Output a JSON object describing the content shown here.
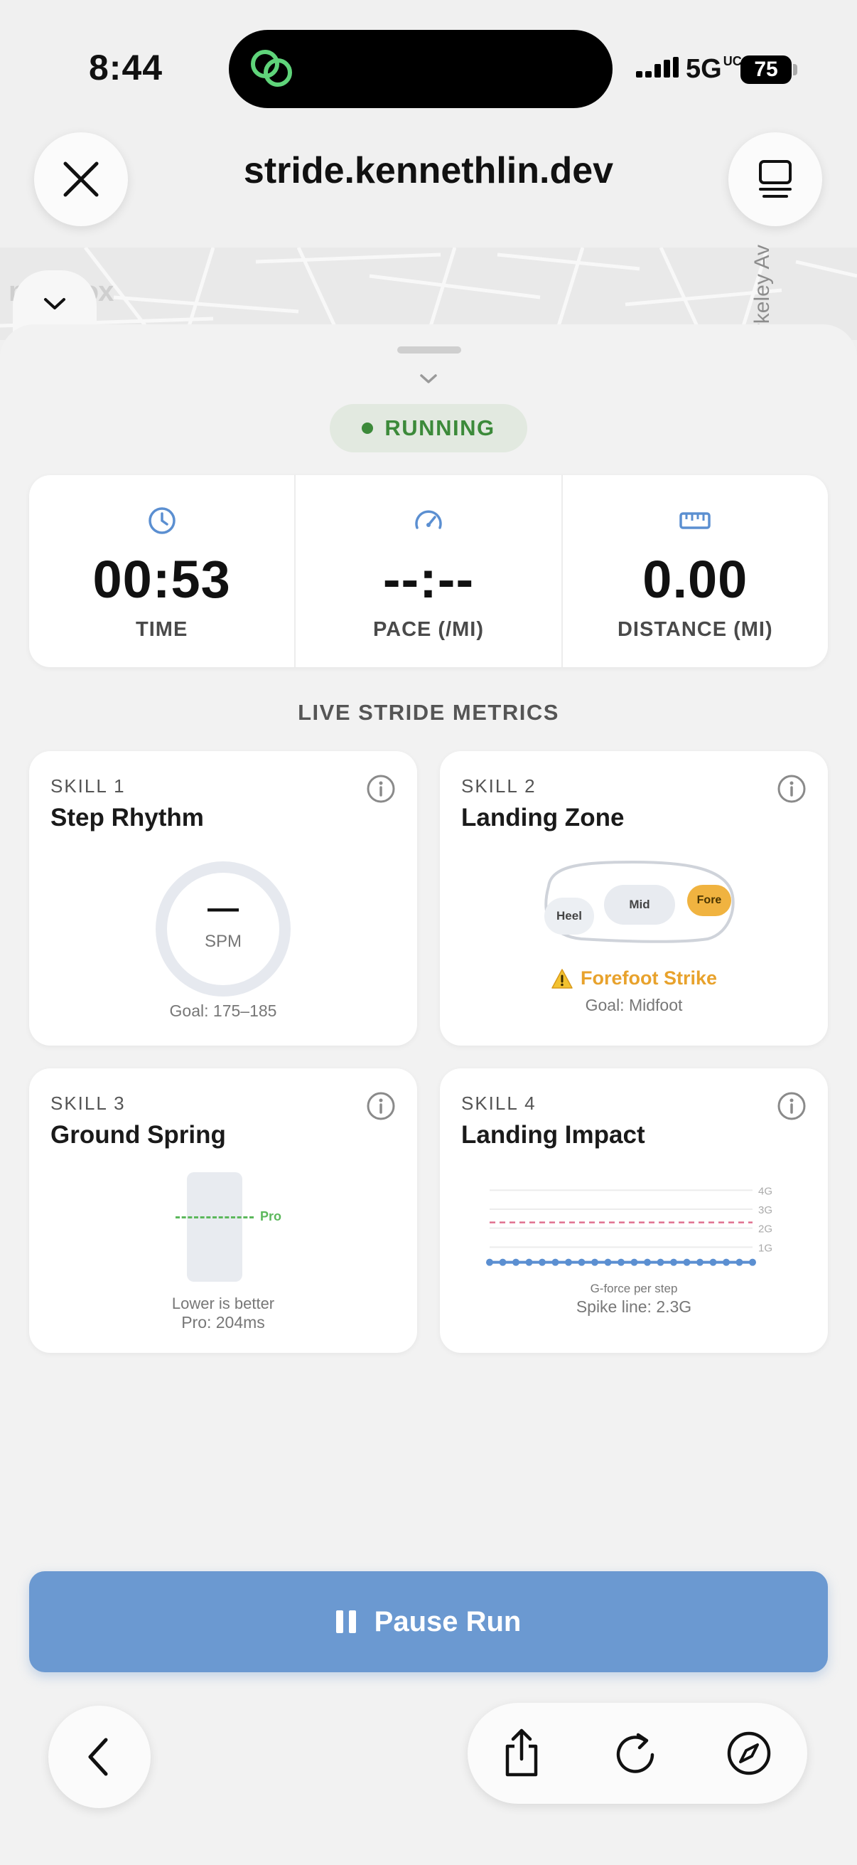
{
  "status_bar": {
    "time": "8:44",
    "network": "5G",
    "network_suffix": "UC",
    "battery": "75"
  },
  "browser": {
    "url": "stride.kennethlin.dev"
  },
  "map": {
    "attribution": "mapbox",
    "street_label": "Berkeley Av"
  },
  "run_status": "RUNNING",
  "stats": [
    {
      "icon": "clock-icon",
      "value": "00:53",
      "label": "TIME"
    },
    {
      "icon": "speedometer-icon",
      "value": "--:--",
      "label": "PACE (/MI)"
    },
    {
      "icon": "ruler-icon",
      "value": "0.00",
      "label": "DISTANCE (MI)"
    }
  ],
  "section_title": "LIVE STRIDE METRICS",
  "skills": {
    "step_rhythm": {
      "tag": "SKILL 1",
      "name": "Step Rhythm",
      "value": "—",
      "unit": "SPM",
      "goal": "Goal: 175–185"
    },
    "landing_zone": {
      "tag": "SKILL 2",
      "name": "Landing Zone",
      "zones": [
        "Heel",
        "Mid",
        "Fore"
      ],
      "active_zone": "Fore",
      "result": "Forefoot Strike",
      "goal": "Goal: Midfoot",
      "colors": {
        "active": "#f0b340",
        "warning": "#e8a22c"
      }
    },
    "ground_spring": {
      "tag": "SKILL 3",
      "name": "Ground Spring",
      "pro_label": "Pro",
      "note": "Lower is better",
      "pro_value": "Pro: 204ms",
      "colors": {
        "pro_line": "#5cb85c"
      }
    },
    "landing_impact": {
      "tag": "SKILL 4",
      "name": "Landing Impact",
      "axis_labels": [
        "4G",
        "3G",
        "2G",
        "1G"
      ],
      "chart_caption": "G-force per step",
      "spike_line": "Spike line: 2.3G",
      "colors": {
        "series": "#5b8fd1",
        "spike": "#e0708f"
      }
    }
  },
  "chart_data": {
    "type": "line",
    "title": "",
    "xlabel": "G-force per step",
    "ylabel": "",
    "ylim": [
      0,
      4.5
    ],
    "yticks": [
      "1G",
      "2G",
      "3G",
      "4G"
    ],
    "reference_line": {
      "label": "Spike line: 2.3G",
      "value": 2.3
    },
    "series": [
      {
        "values": [
          0.2,
          0.2,
          0.2,
          0.2,
          0.2,
          0.2,
          0.2,
          0.2,
          0.2,
          0.2,
          0.2,
          0.2,
          0.2,
          0.2,
          0.2,
          0.2,
          0.2,
          0.2,
          0.2,
          0.2,
          0.2
        ]
      }
    ]
  },
  "actions": {
    "pause_label": "Pause Run"
  },
  "colors": {
    "accent": "#6b99d1",
    "running": "#3c8a3a",
    "icon_blue": "#5b8fd1"
  }
}
